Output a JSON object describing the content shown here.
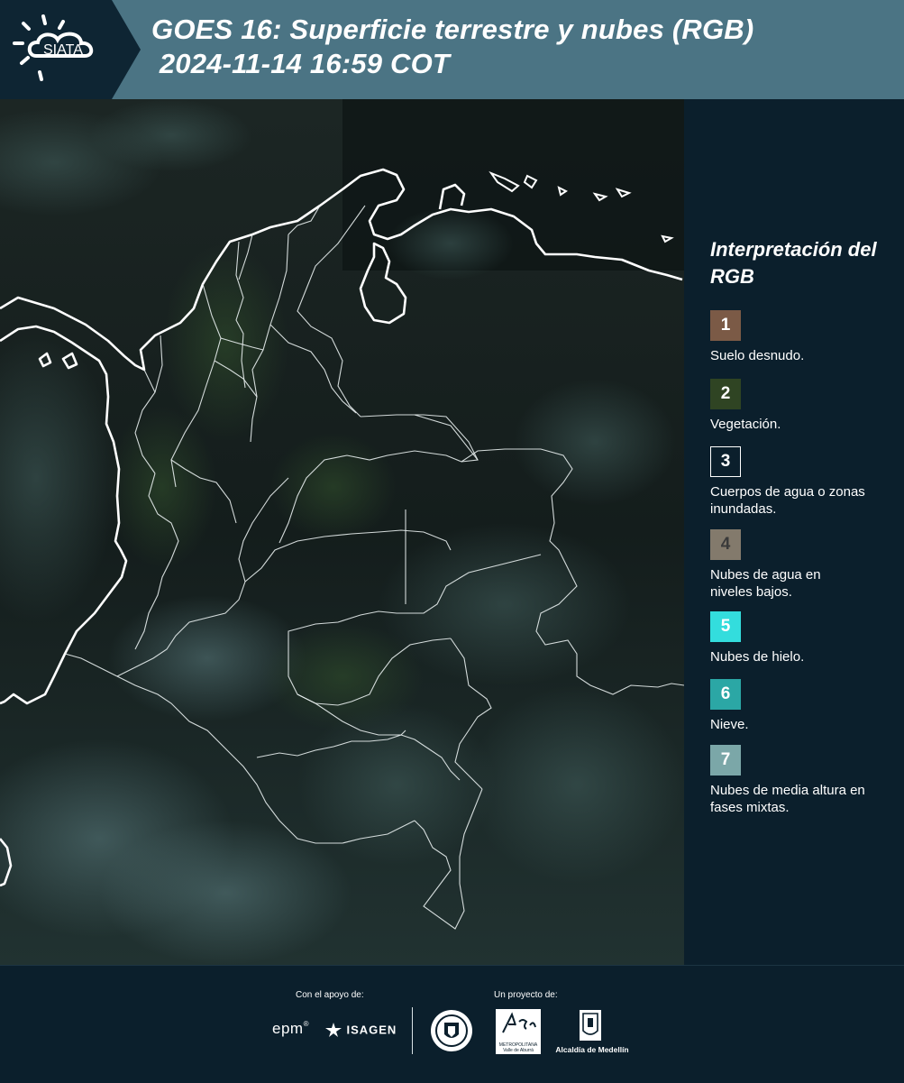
{
  "header": {
    "logo_text": "SIATA",
    "title_line1": "GOES 16: Superficie terrestre y nubes (RGB)",
    "title_line2": " 2024-11-14 16:59 COT"
  },
  "legend": {
    "title": "Interpretación del RGB",
    "items": [
      {
        "num": "1",
        "label": "Suelo desnudo.",
        "color": "#7b5a46"
      },
      {
        "num": "2",
        "label": "Vegetación.",
        "color": "#2f4423"
      },
      {
        "num": "3",
        "label": "Cuerpos de agua o zonas inundadas.",
        "color": "#0b1f2c"
      },
      {
        "num": "4",
        "label": "Nubes de agua en niveles bajos.",
        "color": "#837a6c"
      },
      {
        "num": "5",
        "label": "Nubes de hielo.",
        "color": "#33dddd"
      },
      {
        "num": "6",
        "label": "Nieve.",
        "color": "#2ba7a5"
      },
      {
        "num": "7",
        "label": "Nubes de media altura en fases mixtas.",
        "color": "#7ba7a8"
      }
    ]
  },
  "footer": {
    "support_label": "Con el apoyo de:",
    "project_label": "Un proyecto de:",
    "epm": "epm",
    "isagen": "ISAGEN",
    "metropolitana": "METROPOLITANA",
    "valle": "Valle de Aburrá",
    "alcaldia": "Alcaldía de Medellín"
  }
}
